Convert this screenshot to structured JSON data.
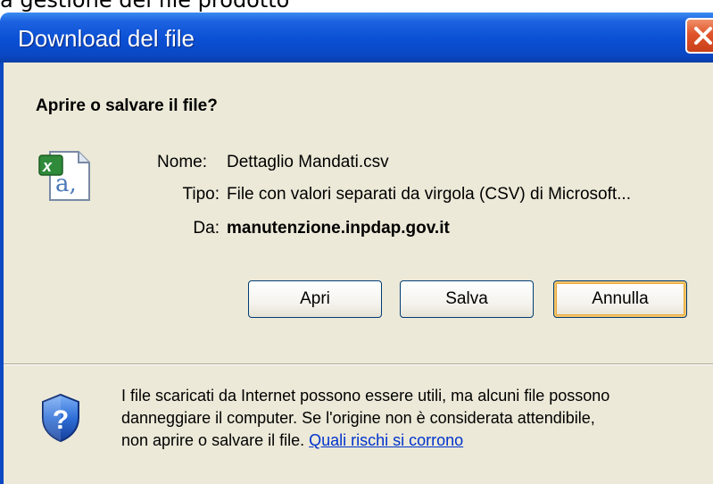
{
  "background": {
    "caption": "a gestione del file prodotto"
  },
  "dialog": {
    "title": "Download del file",
    "question": "Aprire o salvare il file?",
    "file_icon": "excel-csv-file-icon",
    "info": {
      "name_label": "Nome:",
      "name_value": "Dettaglio Mandati.csv",
      "type_label": "Tipo:",
      "type_value": "File con valori separati da virgola (CSV) di Microsoft...",
      "from_label": "Da:",
      "from_value": "manutenzione.inpdap.gov.it"
    },
    "buttons": {
      "open": "Apri",
      "save": "Salva",
      "cancel": "Annulla"
    },
    "warning": {
      "icon": "shield-question-icon",
      "line1": "I file scaricati da Internet possono essere utili, ma alcuni file possono",
      "line2": "danneggiare il computer. Se l'origine non è considerata attendibile,",
      "line3_prefix": "non aprire o salvare il file.",
      "link": "Quali rischi si corrono"
    }
  },
  "colors": {
    "titlebar": "#0a4fd4",
    "close_button": "#e0542a",
    "dialog_body": "#ece9d8",
    "default_button_highlight": "#f5c467",
    "link": "#0033cc"
  }
}
